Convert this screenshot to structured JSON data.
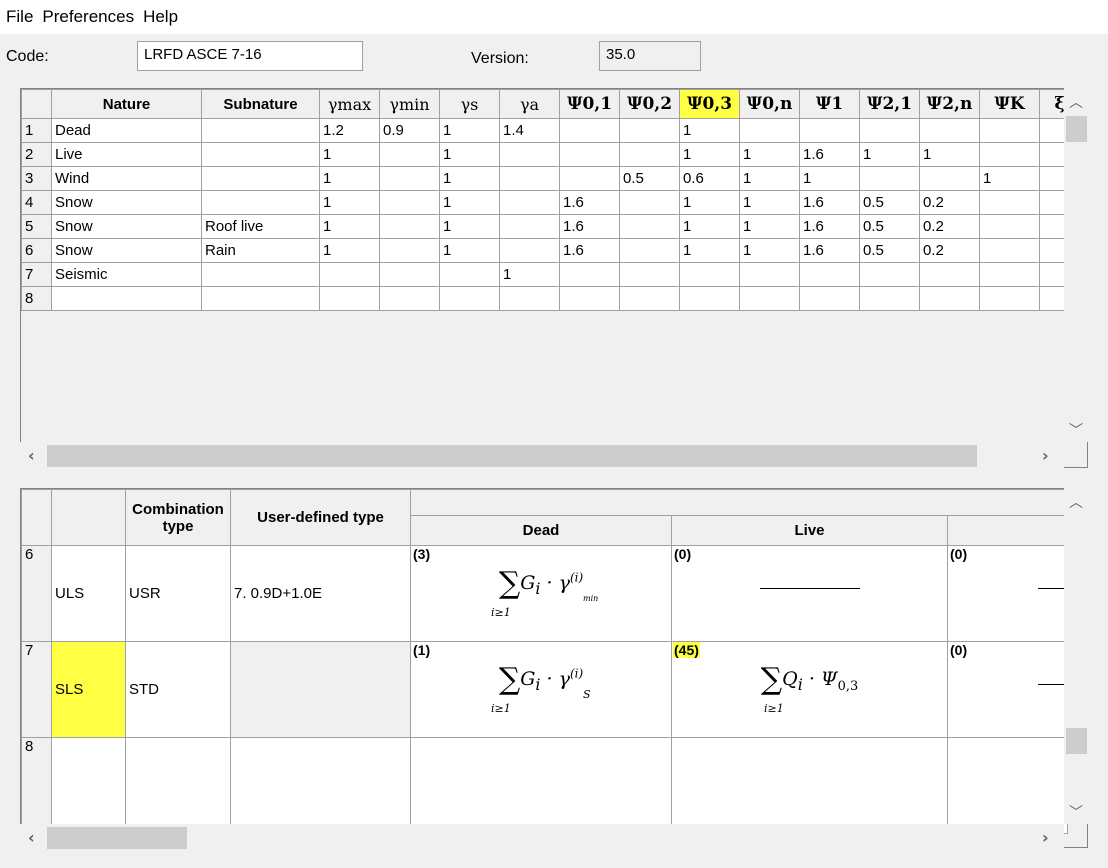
{
  "menu": {
    "file": "File",
    "preferences": "Preferences",
    "help": "Help"
  },
  "codebar": {
    "code_label": "Code:",
    "code_value": "LRFD ASCE 7-16",
    "version_label": "Version:",
    "version_value": "35.0"
  },
  "nature_table": {
    "headers": {
      "nature": "Nature",
      "subnature": "Subnature",
      "gmax": "γmax",
      "gmin": "γmin",
      "gs": "γs",
      "ga": "γa",
      "p01": "Ψ0,1",
      "p02": "Ψ0,2",
      "p03": "Ψ0,3",
      "p0n": "Ψ0,n",
      "p1": "Ψ1",
      "p21": "Ψ2,1",
      "p2n": "Ψ2,n",
      "pk": "ΨK",
      "xi": "ξ"
    },
    "rows": [
      {
        "n": "1",
        "nature": "Dead",
        "sub": "",
        "gmax": "1.2",
        "gmin": "0.9",
        "gs": "1",
        "ga": "1.4",
        "p01": "",
        "p02": "",
        "p03": "1",
        "p0n": "",
        "p1": "",
        "p21": "",
        "p2n": "",
        "pk": ""
      },
      {
        "n": "2",
        "nature": "Live",
        "sub": "",
        "gmax": "1",
        "gmin": "",
        "gs": "1",
        "ga": "",
        "p01": "",
        "p02": "",
        "p03": "1",
        "p0n": "1",
        "p1": "1.6",
        "p21": "1",
        "p2n": "1",
        "pk": ""
      },
      {
        "n": "3",
        "nature": "Wind",
        "sub": "",
        "gmax": "1",
        "gmin": "",
        "gs": "1",
        "ga": "",
        "p01": "",
        "p02": "0.5",
        "p03": "0.6",
        "p0n": "1",
        "p1": "1",
        "p21": "",
        "p2n": "",
        "pk": "1"
      },
      {
        "n": "4",
        "nature": "Snow",
        "sub": "",
        "gmax": "1",
        "gmin": "",
        "gs": "1",
        "ga": "",
        "p01": "1.6",
        "p02": "",
        "p03": "1",
        "p0n": "1",
        "p1": "1.6",
        "p21": "0.5",
        "p2n": "0.2",
        "pk": ""
      },
      {
        "n": "5",
        "nature": "Snow",
        "sub": "Roof live",
        "gmax": "1",
        "gmin": "",
        "gs": "1",
        "ga": "",
        "p01": "1.6",
        "p02": "",
        "p03": "1",
        "p0n": "1",
        "p1": "1.6",
        "p21": "0.5",
        "p2n": "0.2",
        "pk": ""
      },
      {
        "n": "6",
        "nature": "Snow",
        "sub": "Rain",
        "gmax": "1",
        "gmin": "",
        "gs": "1",
        "ga": "",
        "p01": "1.6",
        "p02": "",
        "p03": "1",
        "p0n": "1",
        "p1": "1.6",
        "p21": "0.5",
        "p2n": "0.2",
        "pk": ""
      },
      {
        "n": "7",
        "nature": "Seismic",
        "sub": "",
        "gmax": "",
        "gmin": "",
        "gs": "",
        "ga": "1",
        "p01": "",
        "p02": "",
        "p03": "",
        "p0n": "",
        "p1": "",
        "p21": "",
        "p2n": "",
        "pk": ""
      },
      {
        "n": "8",
        "nature": "",
        "sub": "",
        "gmax": "",
        "gmin": "",
        "gs": "",
        "ga": "",
        "p01": "",
        "p02": "",
        "p03": "",
        "p0n": "",
        "p1": "",
        "p21": "",
        "p2n": "",
        "pk": ""
      }
    ]
  },
  "combo_table": {
    "headers": {
      "combination_type": "Combination type",
      "user_defined_type": "User-defined type",
      "dead": "Dead",
      "live": "Live"
    },
    "rows": [
      {
        "n": "6",
        "state": "ULS",
        "type": "USR",
        "user": "7. 0.9D+1.0E",
        "dead_count": "(3)",
        "live_count": "(0)",
        "next_count": "(0)"
      },
      {
        "n": "7",
        "state": "SLS",
        "type": "STD",
        "user": "",
        "dead_count": "(1)",
        "live_count": "(45)",
        "next_count": "(0)"
      },
      {
        "n": "8",
        "state": "",
        "type": "",
        "user": "",
        "dead_count": "",
        "live_count": "",
        "next_count": ""
      }
    ]
  },
  "highlight_color": "#ffff44",
  "icons": {
    "scroll_up": "chevron-up-icon",
    "scroll_down": "chevron-down-icon",
    "scroll_left": "chevron-left-icon",
    "scroll_right": "chevron-right-icon"
  }
}
